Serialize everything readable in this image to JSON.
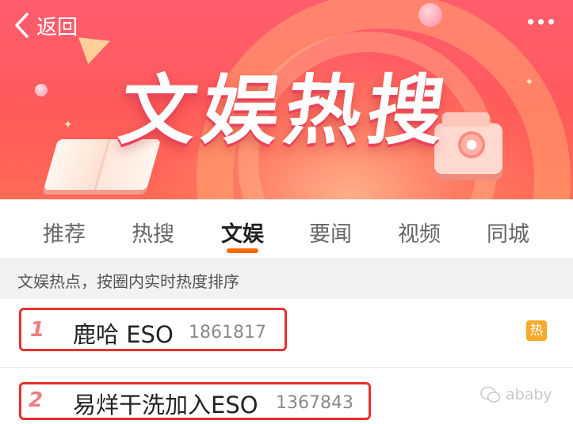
{
  "header": {
    "back_label": "返回",
    "banner_title": "文娱热搜"
  },
  "tabs": [
    {
      "label": "推荐",
      "active": false
    },
    {
      "label": "热搜",
      "active": false
    },
    {
      "label": "文娱",
      "active": true
    },
    {
      "label": "要闻",
      "active": false
    },
    {
      "label": "视频",
      "active": false
    },
    {
      "label": "同城",
      "active": false
    }
  ],
  "section_note": "文娱热点，按圈内实时热度排序",
  "list": [
    {
      "rank": "1",
      "title": "鹿哈 ESO",
      "count": "1861817",
      "badge": "热"
    },
    {
      "rank": "2",
      "title": "易烊干洗加入ESO",
      "count": "1367843"
    }
  ],
  "watermark": "ababy",
  "colors": {
    "accent": "#ff6a00",
    "banner": "#ff5a5a",
    "highlight": "#e8302b",
    "hot_badge": "#f7a928"
  }
}
